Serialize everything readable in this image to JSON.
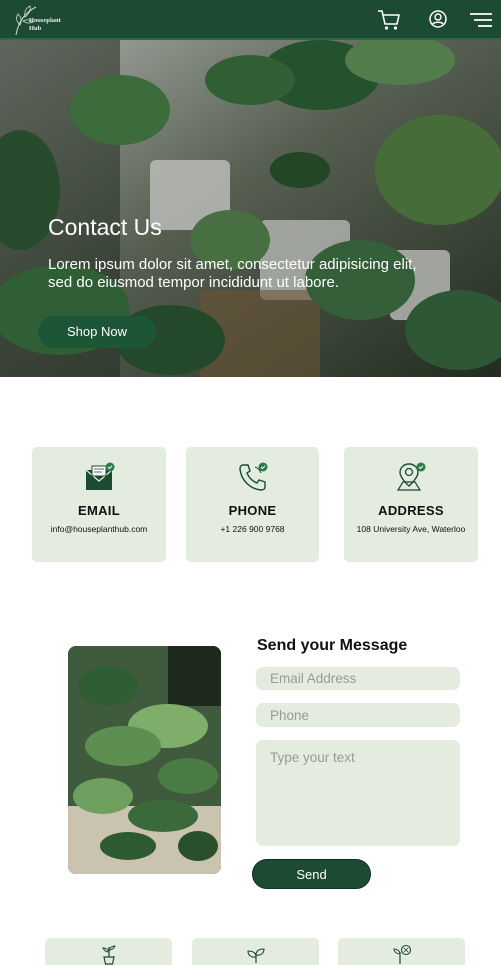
{
  "header": {
    "logo_line1": "Houseplant",
    "logo_line2": "Hub",
    "icons": [
      "cart-icon",
      "user-circle-icon",
      "menu-icon"
    ]
  },
  "hero": {
    "title": "Contact Us",
    "text": "Lorem ipsum dolor sit amet, consectetur adipisicing elit, sed do eiusmod tempor incididunt ut labore.",
    "button_label": "Shop Now"
  },
  "contact_cards": [
    {
      "title": "EMAIL",
      "value": "info@houseplanthub.com",
      "icon": "mail-check-icon"
    },
    {
      "title": "PHONE",
      "value": "+1 226 900 9768",
      "icon": "phone-check-icon"
    },
    {
      "title": "ADDRESS",
      "value": "108 University Ave, Waterloo",
      "icon": "map-pin-check-icon"
    }
  ],
  "form": {
    "title": "Send your Message",
    "email_placeholder": "Email Address",
    "phone_placeholder": "Phone",
    "message_placeholder": "Type your text",
    "send_label": "Send"
  },
  "feature_icons": [
    "potted-plant-icon",
    "leaves-icon",
    "sprout-icon"
  ],
  "colors": {
    "brand_dark": "#1c4a32",
    "card_bg": "#e3ecdf",
    "accent": "#1c5636"
  }
}
